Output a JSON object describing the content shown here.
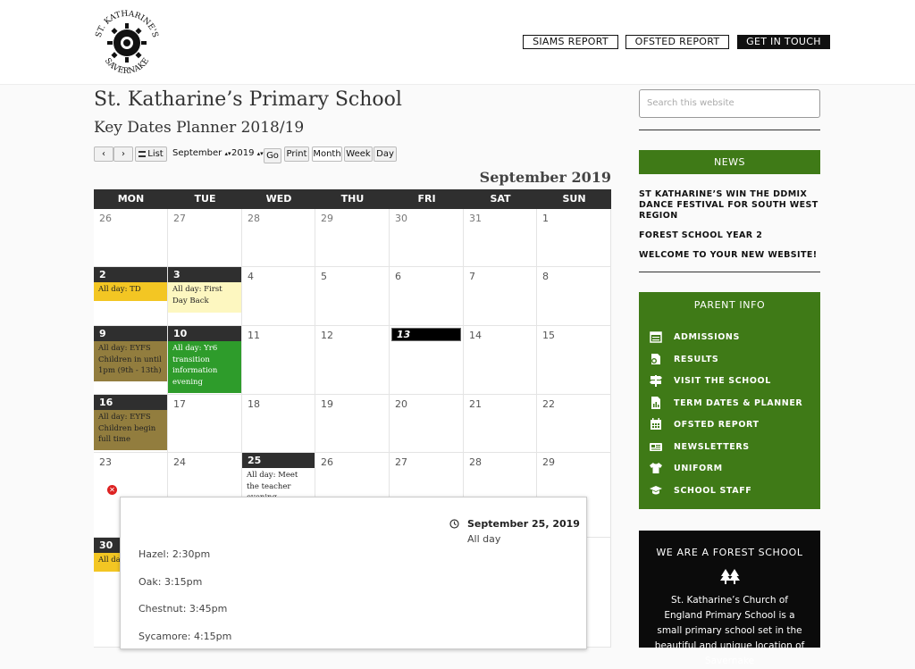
{
  "header": {
    "logo": {
      "arc_top": "ST. KATHARINE'S",
      "arc_bottom": "SAVERNAKE"
    },
    "buttons": [
      "SIAMS REPORT",
      "OFSTED REPORT",
      "GET IN TOUCH"
    ]
  },
  "page": {
    "title": "St. Katharine’s Primary School",
    "subtitle": "Key Dates Planner 2018/19"
  },
  "toolbar": {
    "prev_icon": "‹",
    "next_icon": "›",
    "list_label": "List",
    "month_select": "September",
    "year_select": "2019",
    "go_label": "Go",
    "print_label": "Print",
    "view_month": "Month",
    "view_week": "Week",
    "view_day": "Day"
  },
  "calendar": {
    "month_title": "September 2019",
    "days_of_week": [
      "MON",
      "TUE",
      "WED",
      "THU",
      "FRI",
      "SAT",
      "SUN"
    ],
    "weeks": [
      [
        "26",
        "27",
        "28",
        "29",
        "30",
        "31",
        "1"
      ],
      [
        "2",
        "3",
        "4",
        "5",
        "6",
        "7",
        "8"
      ],
      [
        "9",
        "10",
        "11",
        "12",
        "13",
        "14",
        "15"
      ],
      [
        "16",
        "17",
        "18",
        "19",
        "20",
        "21",
        "22"
      ],
      [
        "23",
        "24",
        "25",
        "26",
        "27",
        "28",
        "29"
      ],
      [
        "30",
        "",
        "",
        "",
        "",
        "",
        ""
      ]
    ],
    "events": {
      "w1d0": "All day: TD",
      "w1d1": "All day: First Day Back",
      "w2d0": "All day: EYFS Children in until 1pm (9th - 13th)",
      "w2d1": "All day: Yr6 transition information evening",
      "w3d0": "All day: EYFS Children begin full time",
      "w4d2": "All day: Meet the teacher evening",
      "w5d0": "All day"
    },
    "event_colors": {
      "yellow": "#f3c623",
      "cream": "#fdf7c0",
      "olive": "#927d3e",
      "green": "#2e9c2b"
    }
  },
  "popup": {
    "date": "September 25, 2019",
    "time": "All day",
    "lines": [
      "Hazel: 2:30pm",
      "Oak: 3:15pm",
      "Chestnut: 3:45pm",
      "Sycamore: 4:15pm"
    ]
  },
  "sidebar": {
    "search_placeholder": "Search this website",
    "news_heading": "NEWS",
    "news_items": [
      "ST KATHARINE’S WIN THE DDMIX DANCE FESTIVAL FOR SOUTH WEST REGION",
      "FOREST SCHOOL YEAR 2",
      "WELCOME TO YOUR NEW WEBSITE!"
    ],
    "parent_heading": "PARENT INFO",
    "parent_items": [
      {
        "label": "ADMISSIONS",
        "icon": "calendar-list-icon"
      },
      {
        "label": "RESULTS",
        "icon": "certificate-icon"
      },
      {
        "label": "VISIT THE SCHOOL",
        "icon": "signpost-icon"
      },
      {
        "label": "TERM DATES & PLANNER",
        "icon": "document-chart-icon"
      },
      {
        "label": "OFSTED REPORT",
        "icon": "calendar-grid-icon"
      },
      {
        "label": "NEWSLETTERS",
        "icon": "newspaper-icon"
      },
      {
        "label": "UNIFORM",
        "icon": "tshirt-icon"
      },
      {
        "label": "SCHOOL STAFF",
        "icon": "graduation-cap-icon"
      }
    ],
    "forest_heading": "WE ARE A FOREST SCHOOL",
    "forest_text": "St. Katharine’s Church of England Primary School is a small primary school set in the beautiful and unique location of Savernake"
  },
  "colors": {
    "accent_green": "#3f7a17",
    "dark": "#2f2f2f"
  }
}
